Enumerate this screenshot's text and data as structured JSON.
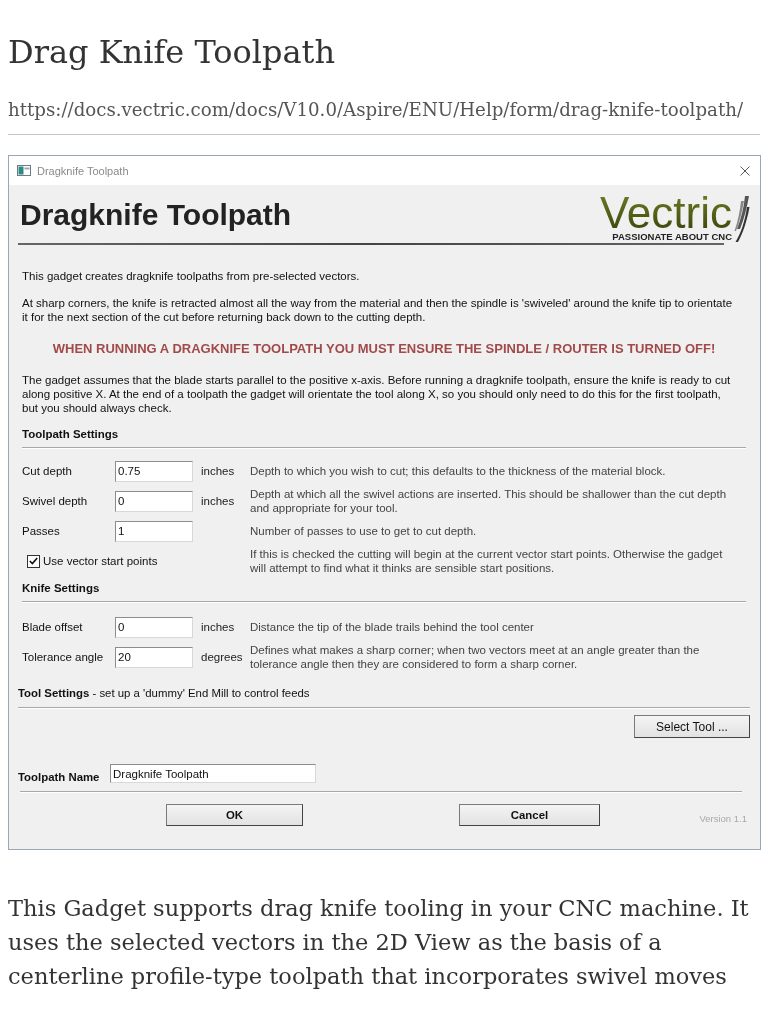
{
  "page": {
    "title": "Drag Knife Toolpath",
    "url": "https://docs.vectric.com/docs/V10.0/Aspire/ENU/Help/form/drag-knife-toolpath/"
  },
  "window": {
    "title": "Dragknife Toolpath"
  },
  "dialog": {
    "heading": "Dragknife Toolpath",
    "logo": {
      "wordmark": "Vectric",
      "tagline": "PASSIONATE ABOUT CNC"
    },
    "paragraphs": [
      {
        "kind": "text",
        "text": "This gadget creates dragknife toolpaths from pre-selected vectors."
      },
      {
        "kind": "text",
        "text": "At sharp corners, the knife is retracted almost all the way from the material and then the spindle is 'swiveled' around the knife tip to orientate it for the next section of the cut before returning back down to the cutting depth."
      },
      {
        "kind": "warning",
        "text": "WHEN RUNNING A DRAGKNIFE TOOLPATH YOU MUST ENSURE THE SPINDLE / ROUTER IS TURNED OFF!"
      },
      {
        "kind": "text",
        "text": "The gadget assumes that the blade starts parallel to the positive x-axis. Before running a dragknife toolpath, ensure the knife is ready to cut along positive X. At the end of a toolpath the gadget will orientate the tool along X, so you should only need to do this for the first toolpath, but you should always check."
      }
    ],
    "sections": [
      {
        "title": "Toolpath Settings",
        "fields": [
          {
            "kind": "input",
            "label": "Cut depth",
            "value": "0.75",
            "unit": "inches",
            "description": "Depth to which you wish to cut; this defaults to the thickness of the material block."
          },
          {
            "kind": "input",
            "label": "Swivel depth",
            "value": "0",
            "unit": "inches",
            "description": "Depth at which all the swivel actions are inserted. This should be shallower than the cut depth and appropriate for your tool."
          },
          {
            "kind": "input",
            "label": "Passes",
            "value": "1",
            "description": "Number of passes to use to get to cut depth."
          },
          {
            "kind": "checkbox",
            "label": "Use vector start points",
            "checked": true,
            "description": "If this is checked the cutting will begin at the current vector start points. Otherwise the gadget will attempt to find what it thinks are sensible start positions."
          }
        ]
      },
      {
        "title": "Knife Settings",
        "fields": [
          {
            "kind": "input",
            "label": "Blade offset",
            "value": "0",
            "unit": "inches",
            "description": "Distance the tip of the blade trails behind the tool center"
          },
          {
            "kind": "input",
            "label": "Tolerance angle",
            "value": "20",
            "unit": "degrees",
            "description": "Defines what makes a sharp corner; when two vectors meet at an angle greater than the tolerance angle then they are considered to form a sharp corner."
          }
        ]
      }
    ],
    "tool_settings": {
      "text": "**Tool Settings** - set up a 'dummy' End Mill to control feeds",
      "button": "Select Tool ..."
    },
    "toolpath_name": {
      "label": "Toolpath Name",
      "value": "Dragknife Toolpath"
    },
    "buttons": [
      "OK",
      "Cancel"
    ],
    "version": "Version 1.1"
  },
  "article": {
    "text": "This Gadget supports drag knife tooling in your CNC machine. It uses the selected vectors in the 2D View as the basis of a centerline profile-type toolpath that incorporates swivel moves"
  }
}
